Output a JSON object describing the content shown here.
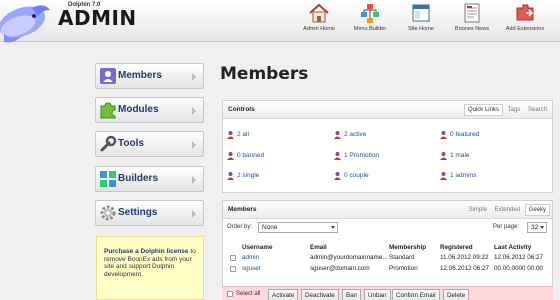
{
  "brand": {
    "version": "Dolphin 7.0",
    "title": "ADMIN"
  },
  "top_nav": [
    {
      "label": "Admin Home",
      "icon": "house-icon"
    },
    {
      "label": "Menu Builder",
      "icon": "menu-builder-icon"
    },
    {
      "label": "Site Home",
      "icon": "site-home-icon"
    },
    {
      "label": "Boonex News",
      "icon": "news-icon"
    },
    {
      "label": "Add Extensions",
      "icon": "extensions-icon"
    }
  ],
  "sidebar": {
    "items": [
      {
        "label": "Members",
        "icon": "members-icon"
      },
      {
        "label": "Modules",
        "icon": "puzzle-icon"
      },
      {
        "label": "Tools",
        "icon": "wrench-icon"
      },
      {
        "label": "Builders",
        "icon": "builders-icon"
      },
      {
        "label": "Settings",
        "icon": "gear-icon"
      }
    ],
    "promo": {
      "title": "Purchase a Dolphin license",
      "text": "to remove BoonEx ads from your site and support Dolphin development."
    }
  },
  "main": {
    "title": "Members",
    "controls": {
      "title": "Controls",
      "tabs": [
        "Quick Links",
        "Tags",
        "Search"
      ],
      "links": [
        "2 all",
        "2 active",
        "0 featured",
        "0 banned",
        "1 Promotion",
        "1 male",
        "2 single",
        "0 couple",
        "1 admins"
      ]
    },
    "members": {
      "title": "Members",
      "tabs": [
        "Simple",
        "Extended",
        "Geeky"
      ],
      "order_label": "Order by:",
      "order_value": "None",
      "per_page_label": "Per page:",
      "per_page_value": "32",
      "columns": [
        "Username",
        "Email",
        "Membership",
        "Registered",
        "Last Activity"
      ],
      "rows": [
        [
          "admin",
          "admin@yourdomainname...",
          "Standard",
          "11.06.2012 09:22",
          "12.06.2012 06:27"
        ],
        [
          "sguser",
          "sguser@domain.com",
          "Promotion",
          "12.06.2012 06:27",
          "00.00.0000 00:00"
        ]
      ]
    },
    "actions": {
      "select_all": "Select all",
      "buttons": [
        "Activate",
        "Deactivate",
        "Ban",
        "Unban",
        "Confirm Email",
        "Delete"
      ]
    }
  },
  "colors": {
    "link": "#1d4fa0",
    "promo_bg": "#ffffc6",
    "action_bar_bg": "#ffd9dc"
  }
}
